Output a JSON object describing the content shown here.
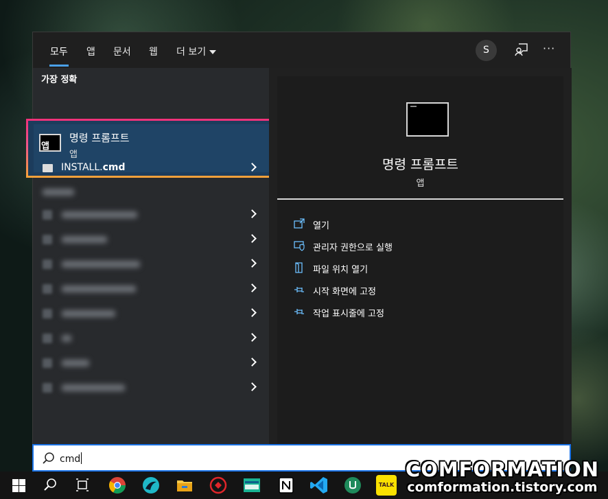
{
  "tabs": [
    {
      "label": "모두",
      "active": true
    },
    {
      "label": "앱",
      "active": false
    },
    {
      "label": "문서",
      "active": false
    },
    {
      "label": "웹",
      "active": false
    },
    {
      "label": "더 보기",
      "active": false
    }
  ],
  "header": {
    "avatar_initial": "S",
    "more_label": "···"
  },
  "left": {
    "best_match_heading": "가장 정확",
    "best_match": {
      "title": "명령 프롬프트",
      "subtitle": "앱",
      "icon": "cmd-icon"
    },
    "apps_heading": "앱",
    "apps": [
      {
        "name_prefix": "INSTALL.",
        "name_bold": "cmd",
        "icon": "file-icon"
      }
    ]
  },
  "preview": {
    "title": "명령 프롬프트",
    "subtitle": "앱",
    "actions": [
      {
        "label": "열기",
        "icon": "open-icon"
      },
      {
        "label": "관리자 권한으로 실행",
        "icon": "shield-icon"
      },
      {
        "label": "파일 위치 열기",
        "icon": "folder-icon"
      },
      {
        "label": "시작 화면에 고정",
        "icon": "pin-icon"
      },
      {
        "label": "작업 표시줄에 고정",
        "icon": "pin-icon"
      }
    ]
  },
  "search": {
    "value": "cmd"
  },
  "taskbar": {
    "items": [
      "windows-start-icon",
      "search-icon",
      "task-view-icon",
      "chrome-icon",
      "app-icon",
      "file-explorer-icon",
      "app-icon",
      "app-icon",
      "notion-icon",
      "vscode-icon",
      "app-icon",
      "kakaotalk-icon"
    ],
    "kakao_label": "TALK"
  },
  "watermark": {
    "line1": "COMFORMATION",
    "line2": "comformation.tistory.com"
  },
  "colors": {
    "accent": "#1a73e8",
    "selected_bg": "#1f4466",
    "panel_bg": "#202020",
    "left_bg": "#282a2d"
  }
}
